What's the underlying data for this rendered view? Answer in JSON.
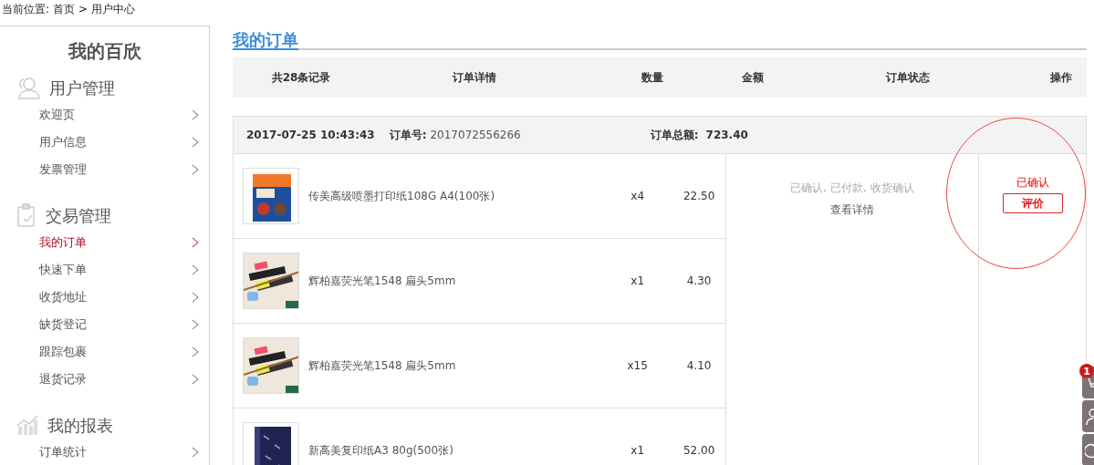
{
  "breadcrumb": {
    "label": "当前位置:",
    "items": [
      "首页",
      "用户中心"
    ],
    "separator": ">"
  },
  "sidebar": {
    "title": "我的百欣",
    "groups": [
      {
        "title": "用户管理",
        "items": [
          {
            "label": "欢迎页",
            "selected": false
          },
          {
            "label": "用户信息",
            "selected": false
          },
          {
            "label": "发票管理",
            "selected": false
          }
        ]
      },
      {
        "title": "交易管理",
        "items": [
          {
            "label": "我的订单",
            "selected": true
          },
          {
            "label": "快速下单",
            "selected": false
          },
          {
            "label": "收货地址",
            "selected": false
          },
          {
            "label": "缺货登记",
            "selected": false
          },
          {
            "label": "跟踪包裹",
            "selected": false
          },
          {
            "label": "退货记录",
            "selected": false
          }
        ]
      },
      {
        "title": "我的报表",
        "items": [
          {
            "label": "订单统计",
            "selected": false
          }
        ]
      }
    ]
  },
  "main": {
    "title": "我的订单",
    "columns": [
      "共28条记录",
      "订单详情",
      "数量",
      "金额",
      "订单状态",
      "操作"
    ],
    "orders": [
      {
        "date": "2017-07-25 10:43:43",
        "number_label": "订单号:",
        "number": "2017072556266",
        "total_label": "订单总额:",
        "total": "723.40",
        "status": "已确认, 已付款, 收货确认",
        "details_link": "查看详情",
        "action_status": "已确认",
        "action_button": "评价",
        "items": [
          {
            "name": "传美高级喷墨打印纸108G A4(100张)",
            "qty": "x4",
            "price": "22.50"
          },
          {
            "name": "辉柏嘉荧光笔1548 扁头5mm",
            "qty": "x1",
            "price": "4.30"
          },
          {
            "name": "辉柏嘉荧光笔1548 扁头5mm",
            "qty": "x15",
            "price": "4.10"
          },
          {
            "name": "新高美复印纸A3 80g(500张)",
            "qty": "x1",
            "price": "52.00"
          }
        ]
      }
    ]
  },
  "float_toolbar": {
    "badge": "1"
  }
}
